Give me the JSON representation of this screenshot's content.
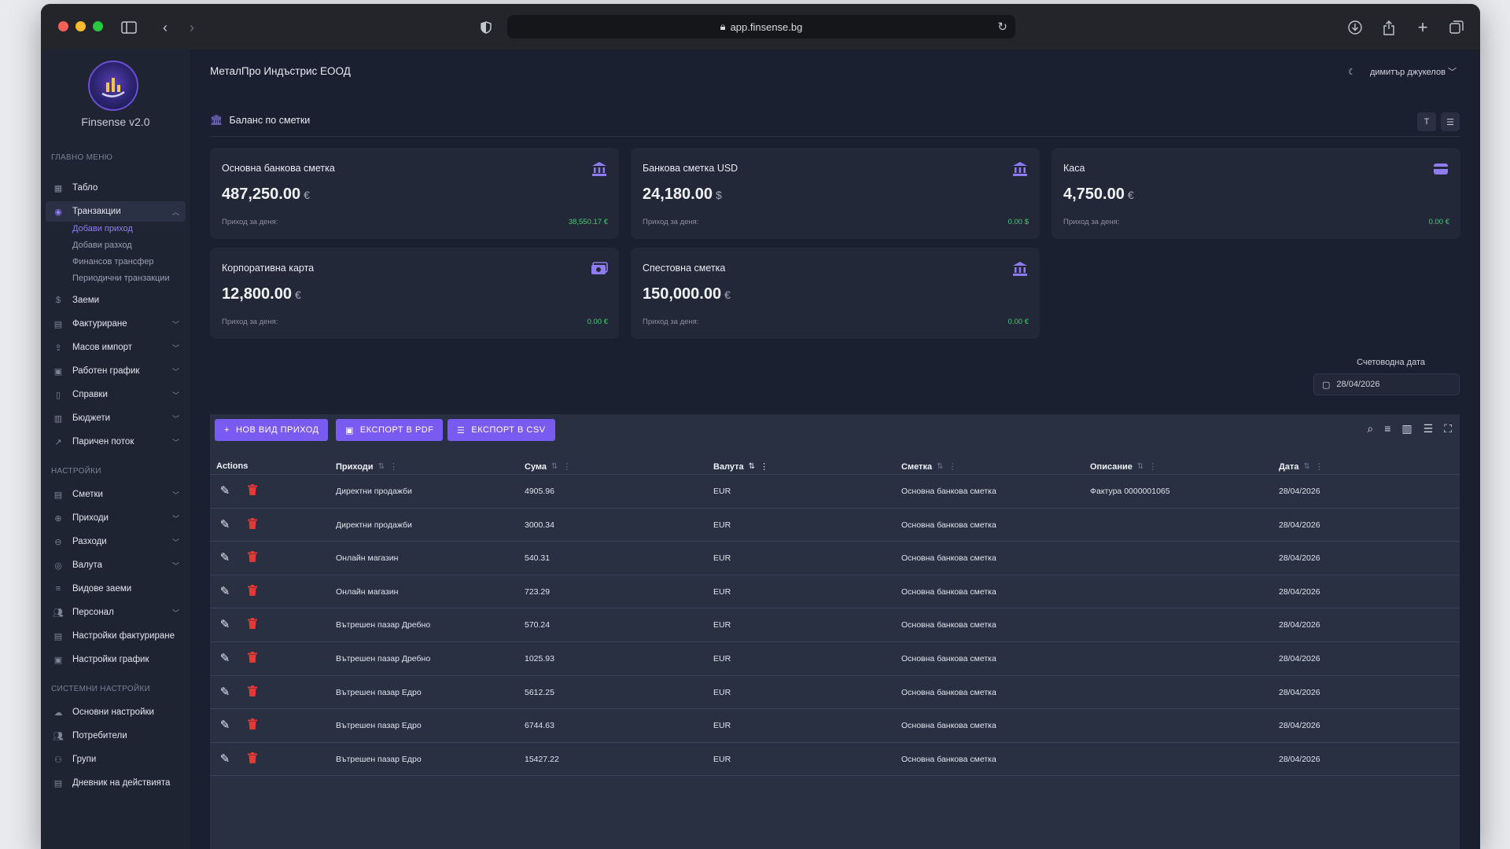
{
  "browser": {
    "url": "app.finsense.bg"
  },
  "sidebar": {
    "brand": "Finsense v2.0",
    "sections": {
      "main": "ГЛАВНО МЕНЮ",
      "settings": "НАСТРОЙКИ",
      "system": "СИСТЕМНИ НАСТРОЙКИ"
    },
    "items": {
      "dashboard": "Табло",
      "transactions": "Транзакции",
      "loans": "Заеми",
      "invoicing": "Фактуриране",
      "import": "Масов импорт",
      "schedule": "Работен график",
      "reports": "Справки",
      "budgets": "Бюджети",
      "cashflow": "Паричен поток",
      "accounts": "Сметки",
      "incomes": "Приходи",
      "expenses": "Разходи",
      "currency": "Валута",
      "loan_types": "Видове заеми",
      "staff": "Персонал",
      "invoice_settings": "Настройки фактуриране",
      "schedule_settings": "Настройки график",
      "general_settings": "Основни настройки",
      "users": "Потребители",
      "groups": "Групи",
      "activity_log": "Дневник на действията"
    },
    "subitems": {
      "add_income": "Добави приход",
      "add_expense": "Добави разход",
      "transfer": "Финансов трансфер",
      "periodic": "Периодични транзакции"
    }
  },
  "header": {
    "company": "МеталПро Индъстрис ЕООД",
    "user": "димитър джукелов"
  },
  "balance": {
    "title": "Баланс по сметки",
    "income_label": "Приход за деня:",
    "cards": [
      {
        "name": "Основна банкова сметка",
        "amount": "487,250.00",
        "currency": "€",
        "today": "38,550.17 €",
        "icon": "bank-icon"
      },
      {
        "name": "Банкова сметка USD",
        "amount": "24,180.00",
        "currency": "$",
        "today": "0.00 $",
        "icon": "bank-icon"
      },
      {
        "name": "Каса",
        "amount": "4,750.00",
        "currency": "€",
        "today": "0.00 €",
        "icon": "wallet-icon"
      },
      {
        "name": "Корпоративна карта",
        "amount": "12,800.00",
        "currency": "€",
        "today": "0.00 €",
        "icon": "cash-icon"
      },
      {
        "name": "Спестовна сметка",
        "amount": "150,000.00",
        "currency": "€",
        "today": "0.00 €",
        "icon": "bank-icon"
      }
    ]
  },
  "accounting_date": {
    "label": "Счетоводна дата",
    "value": "28/04/2026"
  },
  "toolbar": {
    "new_income": "НОВ ВИД ПРИХОД",
    "export_pdf": "ЕКСПОРТ В PDF",
    "export_csv": "ЕКСПОРТ В CSV"
  },
  "table": {
    "columns": [
      "Actions",
      "Приходи",
      "Сума",
      "Валута",
      "Сметка",
      "Описание",
      "Дата"
    ],
    "rows": [
      {
        "income": "Директни продажби",
        "amount": "4905.96",
        "currency": "EUR",
        "account": "Основна банкова сметка",
        "description": "Фактура 0000001065",
        "date": "28/04/2026"
      },
      {
        "income": "Директни продажби",
        "amount": "3000.34",
        "currency": "EUR",
        "account": "Основна банкова сметка",
        "description": "",
        "date": "28/04/2026"
      },
      {
        "income": "Онлайн магазин",
        "amount": "540.31",
        "currency": "EUR",
        "account": "Основна банкова сметка",
        "description": "",
        "date": "28/04/2026"
      },
      {
        "income": "Онлайн магазин",
        "amount": "723.29",
        "currency": "EUR",
        "account": "Основна банкова сметка",
        "description": "",
        "date": "28/04/2026"
      },
      {
        "income": "Вътрешен пазар Дребно",
        "amount": "570.24",
        "currency": "EUR",
        "account": "Основна банкова сметка",
        "description": "",
        "date": "28/04/2026"
      },
      {
        "income": "Вътрешен пазар Дребно",
        "amount": "1025.93",
        "currency": "EUR",
        "account": "Основна банкова сметка",
        "description": "",
        "date": "28/04/2026"
      },
      {
        "income": "Вътрешен пазар Едро",
        "amount": "5612.25",
        "currency": "EUR",
        "account": "Основна банкова сметка",
        "description": "",
        "date": "28/04/2026"
      },
      {
        "income": "Вътрешен пазар Едро",
        "amount": "6744.63",
        "currency": "EUR",
        "account": "Основна банкова сметка",
        "description": "",
        "date": "28/04/2026"
      },
      {
        "income": "Вътрешен пазар Едро",
        "amount": "15427.22",
        "currency": "EUR",
        "account": "Основна банкова сметка",
        "description": "",
        "date": "28/04/2026"
      }
    ]
  },
  "colors": {
    "accent": "#7a5bf2",
    "positive": "#3fcf6e",
    "delete": "#e53935"
  }
}
